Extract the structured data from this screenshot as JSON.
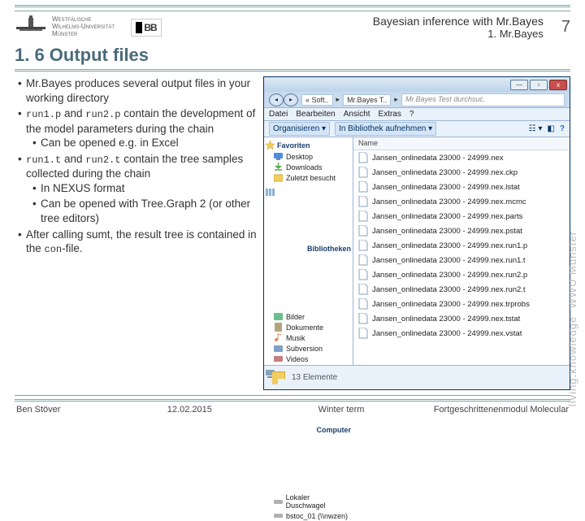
{
  "header": {
    "uni_name_1": "Westfälische",
    "uni_name_2": "Wilhelms-Universität",
    "uni_name_3": "Münster",
    "title1": "Bayesian inference with Mr.Bayes",
    "title2": "1. Mr.Bayes",
    "page": "7"
  },
  "section": {
    "title": "1. 6 Output files"
  },
  "bullets": {
    "b1": "Mr.Bayes produces several output files in your working directory",
    "b2a": "run1.p",
    "b2b": " and ",
    "b2c": "run2.p",
    "b2d": " contain the development of the model parameters during the chain",
    "b2s1": "Can be opened e.g. in Excel",
    "b3a": "run1.t",
    "b3b": " and ",
    "b3c": "run2.t",
    "b3d": " contain the tree samples collected during the chain",
    "b3s1": "In NEXUS format",
    "b3s2": "Can be opened with Tree.Graph 2 (or other tree editors)",
    "b4a": "After calling sumt, the result tree is contained in the ",
    "b4b": "con",
    "b4c": "-file."
  },
  "explorer": {
    "path_seg1": "« Soft..",
    "path_seg2": "Mr.Bayes T..",
    "search_placeholder": "Mr.Bayes Test durchsuc.",
    "menu": [
      "Datei",
      "Bearbeiten",
      "Ansicht",
      "Extras",
      "?"
    ],
    "toolbar1": "Organisieren ▾",
    "toolbar2": "In Bibliothek aufnehmen ▾",
    "col_name": "Name",
    "side": {
      "fav": "Favoriten",
      "fav_items": [
        "Desktop",
        "Downloads",
        "Zuletzt besucht"
      ],
      "lib": "Bibliotheken",
      "lib_items": [
        "Bilder",
        "Dokumente",
        "Musik",
        "Subversion",
        "Videos"
      ],
      "comp": "Computer",
      "comp_items": [
        "Lokaler Duschwagel",
        "bstoc_01 (\\\\nwzen)"
      ]
    },
    "files": [
      "Jansen_onlinedata 23000 - 24999.nex",
      "Jansen_onlinedata 23000 - 24999.nex.ckp",
      "Jansen_onlinedata 23000 - 24999.nex.lstat",
      "Jansen_onlinedata 23000 - 24999.nex.mcmc",
      "Jansen_onlinedata 23000 - 24999.nex.parts",
      "Jansen_onlinedata 23000 - 24999.nex.pstat",
      "Jansen_onlinedata 23000 - 24999.nex.run1.p",
      "Jansen_onlinedata 23000 - 24999.nex.run1.t",
      "Jansen_onlinedata 23000 - 24999.nex.run2.p",
      "Jansen_onlinedata 23000 - 24999.nex.run2.t",
      "Jansen_onlinedata 23000 - 24999.nex.trprobs",
      "Jansen_onlinedata 23000 - 24999.nex.tstat",
      "Jansen_onlinedata 23000 - 24999.nex.vstat"
    ],
    "status": "13 Elemente"
  },
  "brand": {
    "t1": "living",
    "dot": ".",
    "t2": "knowledge",
    "t3": "WWU Münster"
  },
  "footer": {
    "author": "Ben Stöver",
    "date": "12.02.2015",
    "term": "Winter term",
    "course": "Fortgeschrittenenmodul Molecular"
  }
}
